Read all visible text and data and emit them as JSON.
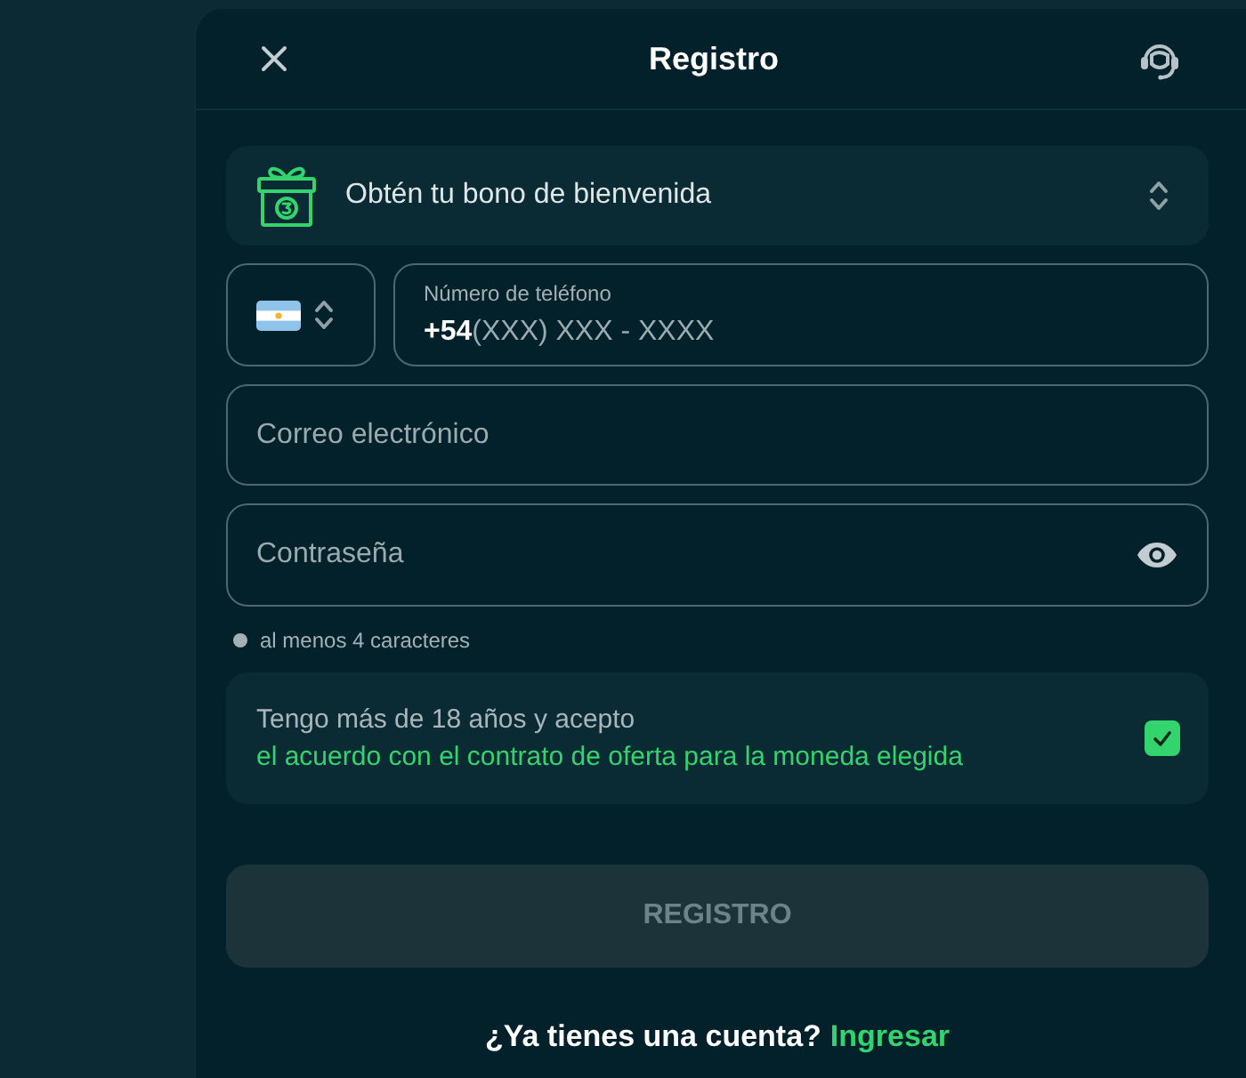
{
  "header": {
    "title": "Registro"
  },
  "bonus": {
    "label": "Obtén tu bono de bienvenida"
  },
  "phone": {
    "label": "Número de teléfono",
    "prefix": "+54",
    "placeholder": "(XXX) XXX - XXXX"
  },
  "email": {
    "placeholder": "Correo electrónico"
  },
  "password": {
    "placeholder": "Contraseña"
  },
  "password_hints": [
    {
      "text": "al menos 4 caracteres",
      "met": false
    }
  ],
  "agreement": {
    "text": "Tengo más de 18 años y acepto",
    "link": "el acuerdo con el contrato de oferta para la moneda elegida",
    "checked": true
  },
  "submit": {
    "label": "REGISTRO",
    "disabled": true
  },
  "footer": {
    "text": "¿Ya tienes una cuenta?",
    "link": "Ingresar"
  }
}
